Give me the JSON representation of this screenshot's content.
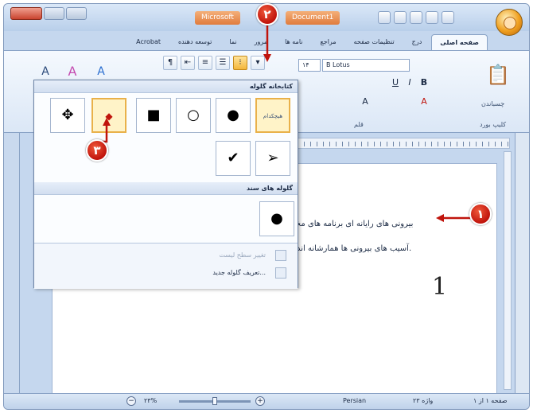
{
  "window": {
    "app_title": "Microsoft",
    "doc_title": "Document1"
  },
  "ribbon_tabs": [
    {
      "label": "صفحه اصلی",
      "active": true
    },
    {
      "label": "درج",
      "active": false
    },
    {
      "label": "تنظیمات صفحه",
      "active": false
    },
    {
      "label": "مراجع",
      "active": false
    },
    {
      "label": "نامه ها",
      "active": false
    },
    {
      "label": "مرور",
      "active": false
    },
    {
      "label": "نما",
      "active": false
    },
    {
      "label": "توسعه دهنده",
      "active": false
    },
    {
      "label": "Acrobat",
      "active": false
    }
  ],
  "font": {
    "name": "B Lotus",
    "size": "۱۴",
    "group_label": "قلم"
  },
  "clipboard": {
    "paste_label": "چسباندن",
    "group_label": "کلیپ بورد"
  },
  "bullet_library": {
    "header": "کتابخانه گلوله",
    "none_label": "هیچکدام",
    "glyphs": [
      "●",
      "○",
      "■",
      "✥",
      "➢",
      "✔"
    ],
    "doc_header": "گلوله های سند",
    "doc_glyph": "●",
    "change_level": "تغییر سطح لیست",
    "define_new": "تعریف گلوله جدید...",
    "selected_glyph_icon": "highlighted-bullet-icon"
  },
  "document": {
    "line1": "بیرونی های رایانه ای برنامه های مخرب",
    "line2": "آسیب های بیرونی ها همارشانه اند.",
    "numeral": "1"
  },
  "callouts": {
    "one": "۱",
    "two": "۲",
    "three": "۳"
  },
  "status_bar": {
    "page_info": "صفحه ۱ از ۱",
    "word_count": "واژه ۲۳",
    "language": "Persian",
    "zoom": "۲۳%"
  },
  "colors": {
    "callout_red": "#c0140c",
    "selection_gold": "#e9b14a",
    "frame_blue": "#c5d7ee"
  }
}
